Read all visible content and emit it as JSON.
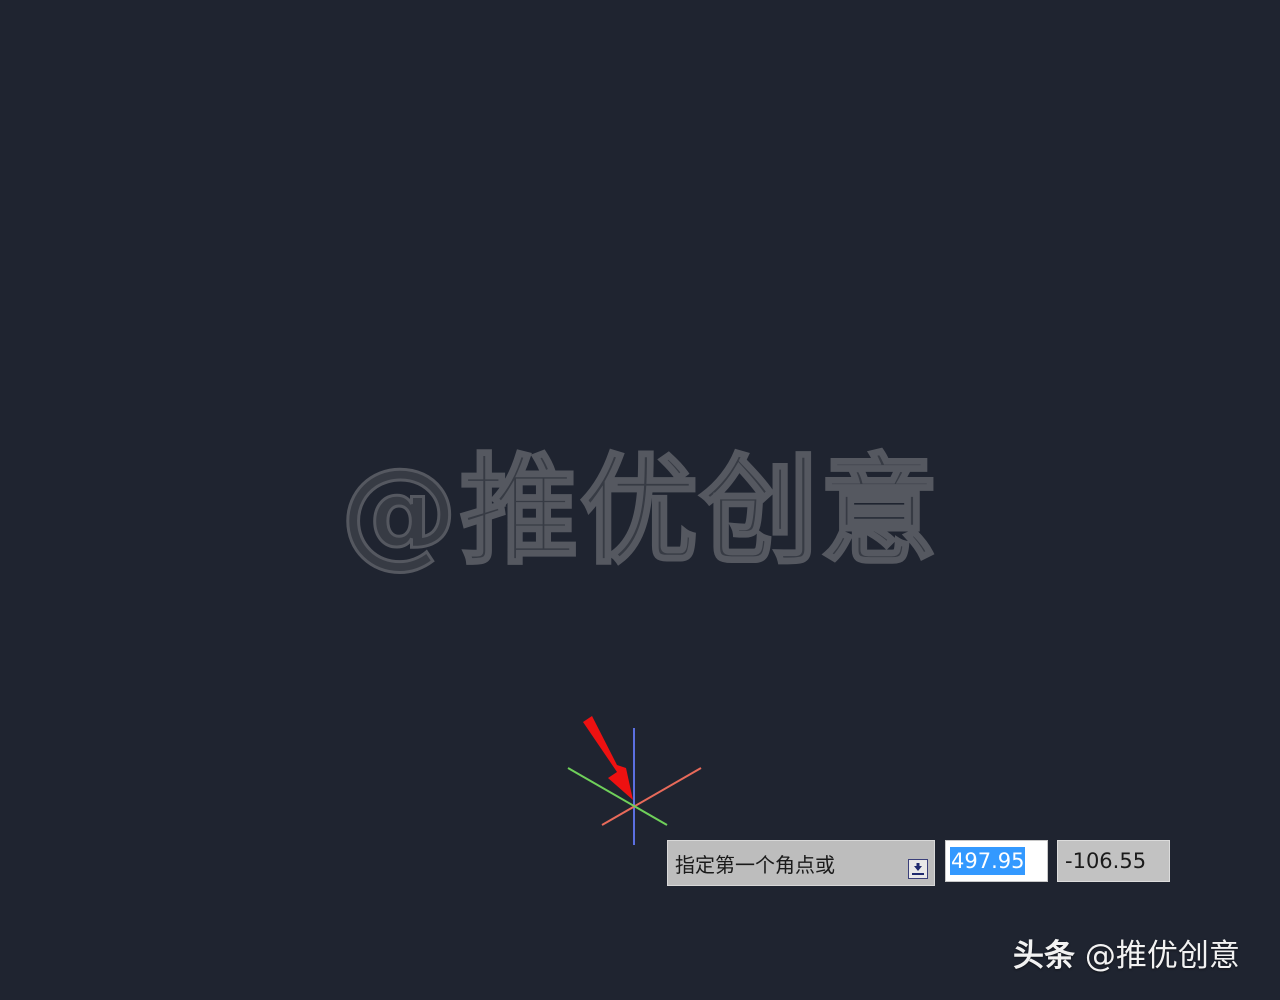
{
  "canvas": {
    "background": "#1f2430"
  },
  "watermark": {
    "text": "@推优创意"
  },
  "cursor": {
    "icon": "crosshair-icon",
    "axis_colors": {
      "vertical": "#5b6fe0",
      "diagonal_a": "#e86a5a",
      "diagonal_b": "#6fd05a"
    }
  },
  "annotation": {
    "icon": "red-arrow-icon",
    "color": "#ee1111"
  },
  "dynamic_input": {
    "prompt": "指定第一个角点或",
    "options_icon": "down-arrow-option-icon",
    "x_value": "497.95",
    "y_value": "-106.55"
  },
  "footer": {
    "brand": "头条",
    "account": "@推优创意"
  }
}
